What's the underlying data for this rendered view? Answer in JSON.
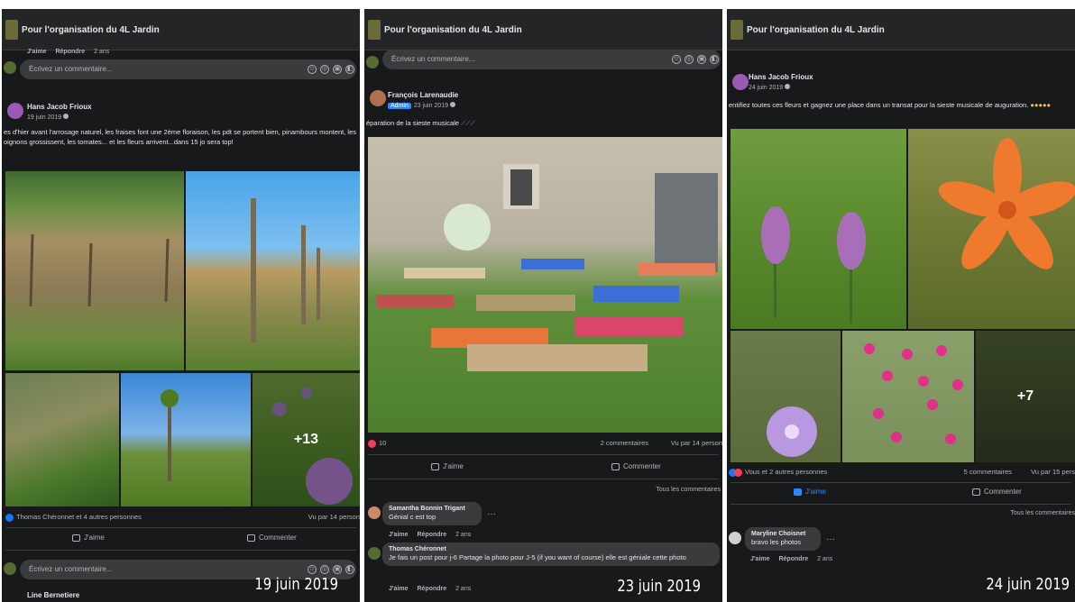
{
  "group_title": "Pour l'organisation du 4L Jardin",
  "like_label": "J'aime",
  "reply_label": "Répondre",
  "comment_placeholder": "Écrivez un commentaire...",
  "comment_action": "Commenter",
  "all_comments": "Tous les commentaires",
  "emoji_icons": [
    "☺",
    "◎",
    "▣",
    "◧"
  ],
  "colors": {
    "background": "#18191a",
    "surface": "#242526",
    "bubble": "#3a3b3c",
    "accent": "#2d88ff",
    "heart": "#f33e58",
    "like": "#1877f2"
  },
  "panel1": {
    "top_actions_time": "2 ans",
    "author": "Hans Jacob Frioux",
    "date": "19 juin 2019",
    "post_text": "es d'hier avant l'arrosage naturel, les fraises font une 2ème floraison, les pdt se portent bien, pinambours montent, les oignons grossissent, les tomates... et les fleurs arrivent...dans 15 jo sera top!",
    "more_photos": "+13",
    "reactions_text": "Thomas Chéronnet et 4 autres personnes",
    "views": "Vu par 14 person",
    "next_author": "Line Bernetiere",
    "date_caption": "19 juin 2019"
  },
  "panel2": {
    "author": "François Larenaudie",
    "admin_badge": "Admin",
    "date": "23 juin 2019",
    "post_text": "éparation de la sieste musicale",
    "reaction_count": "10",
    "comments_count": "2 commentaires",
    "views": "Vu par 14 person",
    "comments": [
      {
        "name": "Samantha Bonnin Trigant",
        "text": "Génial c est top",
        "time": "2 ans"
      },
      {
        "name": "Thomas Chéronnet",
        "text": "Je fais un post pour j-6 Partage la photo pour J-5 (if you want of course) elle est géniale cette photo",
        "time": "2 ans"
      }
    ],
    "date_caption": "23 juin 2019"
  },
  "panel3": {
    "author": "Hans Jacob Frioux",
    "date": "24 juin 2019",
    "post_text": "entifiez toutes ces fleurs et gagnez une place dans un transat pour la sieste musicale de auguration.",
    "more_photos": "+7",
    "reactions_text": "Vous et 2 autres personnes",
    "comments_count": "5 commentaires",
    "views": "Vu par 15 pers",
    "comment": {
      "name": "Maryline Choisnet",
      "text": "bravo les photos",
      "time": "2 ans"
    },
    "date_caption": "24 juin 2019"
  }
}
